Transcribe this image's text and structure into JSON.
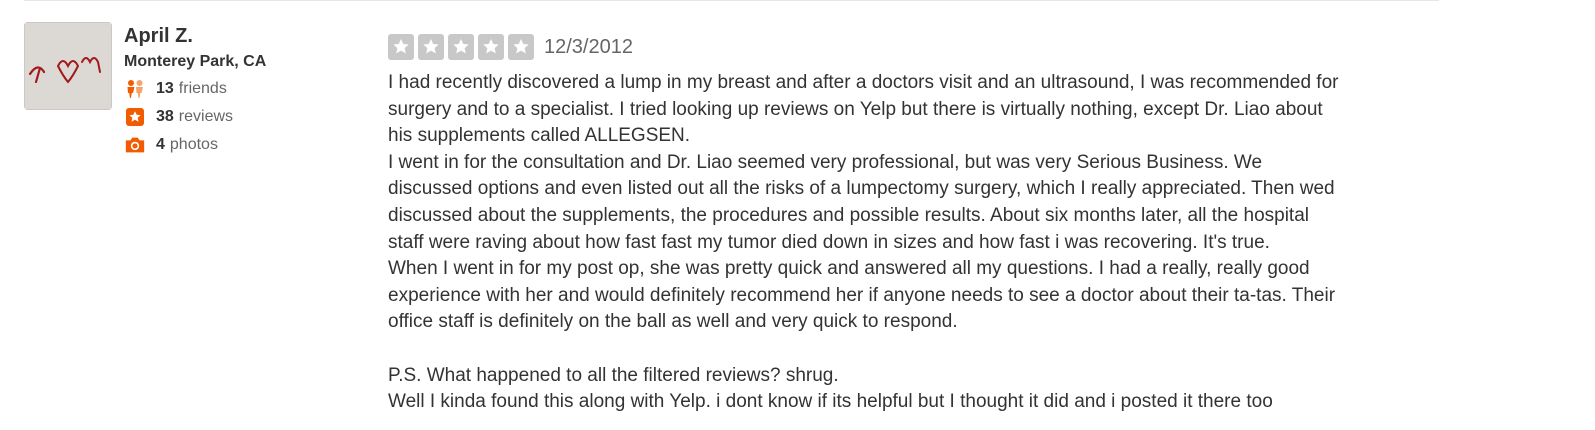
{
  "user": {
    "name": "April Z.",
    "location": "Monterey Park, CA",
    "friends_count": "13",
    "friends_label": "friends",
    "reviews_count": "38",
    "reviews_label": "reviews",
    "photos_count": "4",
    "photos_label": "photos",
    "avatar_icon": "user-photo"
  },
  "review": {
    "rating": 0,
    "max_rating": 5,
    "date": "12/3/2012",
    "lines": [
      "I had recently discovered a lump in my breast and after a doctors visit and an ultrasound, I was recommended for",
      "surgery and to a specialist. I tried looking up reviews on Yelp but there is virtually nothing, except Dr. Liao about",
      "his supplements called ALLEGSEN.",
      "I went in for the consultation and Dr. Liao seemed very professional, but was very Serious Business. We",
      "discussed options and even listed out all the risks of a lumpectomy surgery, which I really appreciated. Then wed",
      "discussed about the supplements, the procedures and possible results. About six months later, all the hospital",
      "staff were raving about how fast fast my tumor died down in sizes and how fast i was recovering. It's true.",
      "When I went in for my post op, she was pretty quick and answered all my questions. I had a really, really good",
      "experience with her and would definitely recommend her if anyone needs to see a doctor about their ta-tas. Their",
      "office staff is definitely on the ball as well and very quick to respond.",
      "",
      "P.S. What happened to all the filtered reviews? shrug.",
      "Well I kinda found this along with Yelp. i dont know if its helpful but I thought it did and i posted it there too"
    ]
  },
  "colors": {
    "accent": "#f15c00",
    "star_empty": "#c8c8c8",
    "text": "#333333",
    "muted": "#666666"
  },
  "icons": {
    "friends": "friends-icon",
    "reviews": "star-badge-icon",
    "photos": "camera-icon",
    "star": "star-icon"
  }
}
